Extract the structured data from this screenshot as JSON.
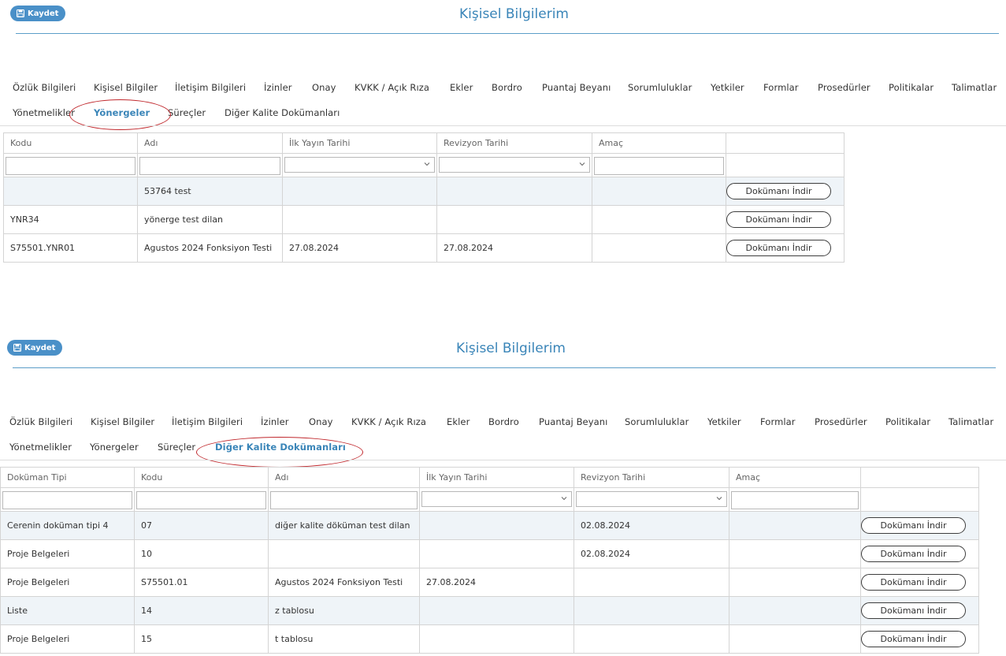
{
  "panel1": {
    "save_label": "Kaydet",
    "title": "Kişisel Bilgilerim",
    "tabs": [
      "Özlük Bilgileri",
      "Kişisel Bilgiler",
      "İletişim Bilgileri",
      "İzinler",
      "Onay",
      "KVKK / Açık Rıza",
      "Ekler",
      "Bordro",
      "Puantaj Beyanı",
      "Sorumluluklar",
      "Yetkiler",
      "Formlar",
      "Prosedürler",
      "Politikalar",
      "Talimatlar",
      "Yönetmelikler",
      "Yönergeler",
      "Süreçler",
      "Diğer Kalite Dokümanları"
    ],
    "active_tab": "Yönergeler",
    "columns": [
      "Kodu",
      "Adı",
      "İlk Yayın Tarihi",
      "Revizyon Tarihi",
      "Amaç",
      ""
    ],
    "rows": [
      {
        "kodu": "",
        "adi": "53764 test",
        "ilk": "",
        "rev": "",
        "amac": "",
        "btn": "Dokümanı İndir"
      },
      {
        "kodu": "YNR34",
        "adi": "yönerge test dilan",
        "ilk": "",
        "rev": "",
        "amac": "",
        "btn": "Dokümanı İndir"
      },
      {
        "kodu": "S75501.YNR01",
        "adi": "Agustos 2024 Fonksiyon Testi",
        "ilk": "27.08.2024",
        "rev": "27.08.2024",
        "amac": "",
        "btn": "Dokümanı İndir"
      }
    ]
  },
  "panel2": {
    "save_label": "Kaydet",
    "title": "Kişisel Bilgilerim",
    "tabs": [
      "Özlük Bilgileri",
      "Kişisel Bilgiler",
      "İletişim Bilgileri",
      "İzinler",
      "Onay",
      "KVKK / Açık Rıza",
      "Ekler",
      "Bordro",
      "Puantaj Beyanı",
      "Sorumluluklar",
      "Yetkiler",
      "Formlar",
      "Prosedürler",
      "Politikalar",
      "Talimatlar",
      "Yönetmelikler",
      "Yönergeler",
      "Süreçler",
      "Diğer Kalite Dokümanları"
    ],
    "active_tab": "Diğer Kalite Dokümanları",
    "columns": [
      "Doküman Tipi",
      "Kodu",
      "Adı",
      "İlk Yayın Tarihi",
      "Revizyon Tarihi",
      "Amaç",
      ""
    ],
    "rows": [
      {
        "tip": "Cerenin doküman tipi 4",
        "kodu": "07",
        "adi": "diğer kalite döküman test dilan",
        "ilk": "",
        "rev": "02.08.2024",
        "amac": "",
        "btn": "Dokümanı İndir"
      },
      {
        "tip": "Proje Belgeleri",
        "kodu": "10",
        "adi": "",
        "ilk": "",
        "rev": "02.08.2024",
        "amac": "",
        "btn": "Dokümanı İndir"
      },
      {
        "tip": "Proje Belgeleri",
        "kodu": "S75501.01",
        "adi": "Agustos 2024 Fonksiyon Testi",
        "ilk": "27.08.2024",
        "rev": "",
        "amac": "",
        "btn": "Dokümanı İndir"
      },
      {
        "tip": "Liste",
        "kodu": "14",
        "adi": "z tablosu",
        "ilk": "",
        "rev": "",
        "amac": "",
        "btn": "Dokümanı İndir"
      },
      {
        "tip": "Proje Belgeleri",
        "kodu": "15",
        "adi": "t tablosu",
        "ilk": "",
        "rev": "",
        "amac": "",
        "btn": "Dokümanı İndir"
      }
    ]
  },
  "colors": {
    "accent": "#3a85b8",
    "save_button": "#4a90c8",
    "highlight_ellipse": "#c0282d",
    "alt_row": "#eff4f8"
  }
}
